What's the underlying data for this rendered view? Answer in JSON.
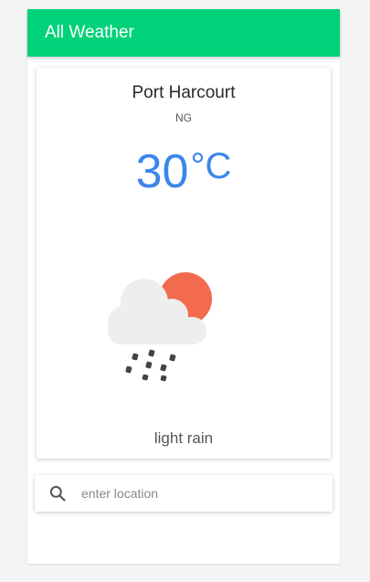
{
  "app": {
    "title": "All Weather"
  },
  "weather": {
    "city": "Port Harcourt",
    "country": "NG",
    "temperature": "30",
    "unit": "°C",
    "description": "light rain",
    "icon": "cloud-sun-rain-icon"
  },
  "search": {
    "placeholder": "enter location",
    "value": ""
  },
  "colors": {
    "appbar": "#00d27a",
    "temperature": "#3d86ea",
    "sun": "#f26b4f",
    "cloud": "#eeeeee"
  }
}
